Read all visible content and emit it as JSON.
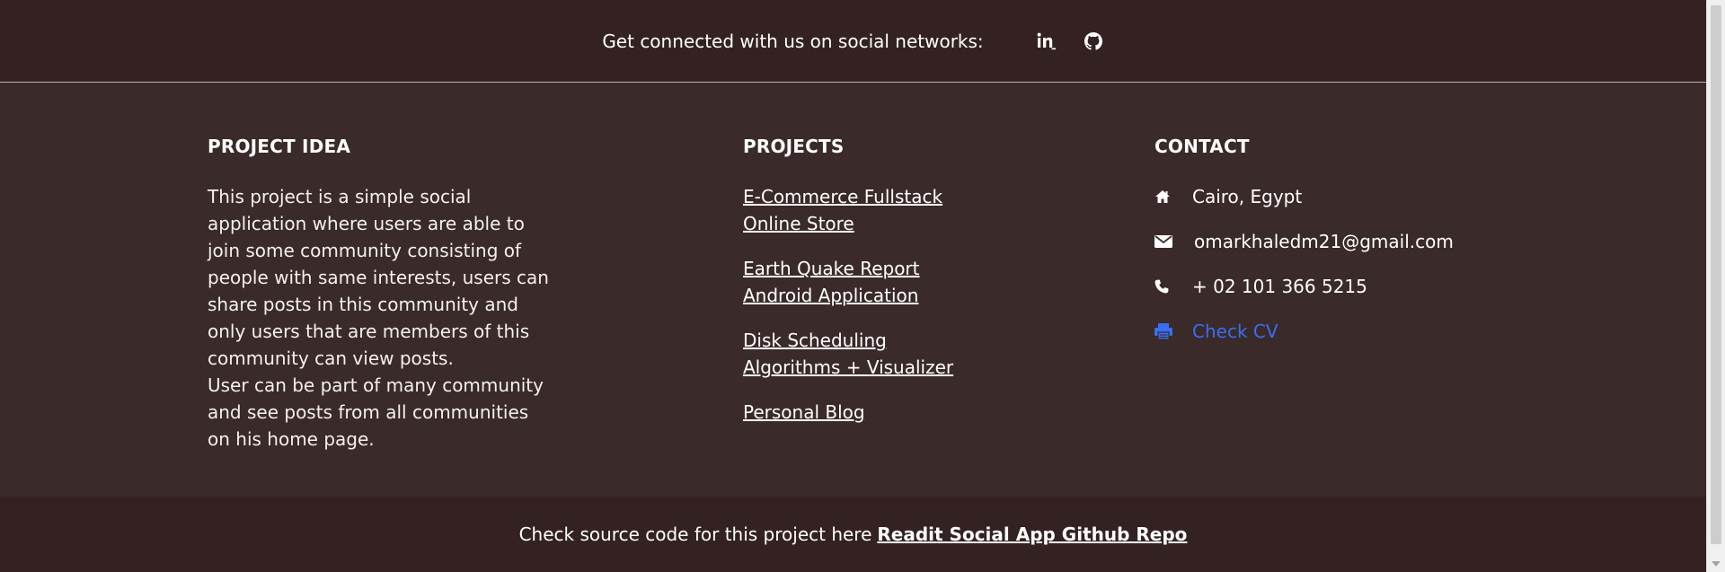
{
  "social": {
    "text": "Get connected with us on social networks:",
    "icons": [
      "linkedin-icon",
      "github-icon"
    ]
  },
  "project_idea": {
    "title": "PROJECT IDEA",
    "description": "This project is a simple social application where users are able to join some community consisting of people with same interests, users can share posts in this community and only users that are members of this community can view posts.",
    "description2": "User can be part of many community and see posts from all communities on his home page."
  },
  "projects": {
    "title": "PROJECTS",
    "items": [
      {
        "line1": "E-Commerce Fullstack",
        "line2": "Online Store"
      },
      {
        "line1": "Earth Quake Report",
        "line2": "Android Application"
      },
      {
        "line1": "Disk Scheduling",
        "line2": "Algorithms + Visualizer"
      },
      {
        "line1": "Personal Blog",
        "line2": ""
      }
    ]
  },
  "contact": {
    "title": "CONTACT",
    "address": "Cairo, Egypt",
    "email": "omarkhaledm21@gmail.com",
    "phone": "+ 02 101 366 5215",
    "cv_label": "Check CV",
    "cv_color": "#3a6ef0"
  },
  "footer": {
    "text": "Check source code for this project here",
    "repo_label": "Readit Social App Github Repo"
  },
  "colors": {
    "background": "#3b2a2a",
    "bar_background": "#342222",
    "text": "#ffffff",
    "link_accent": "#3a6ef0"
  }
}
